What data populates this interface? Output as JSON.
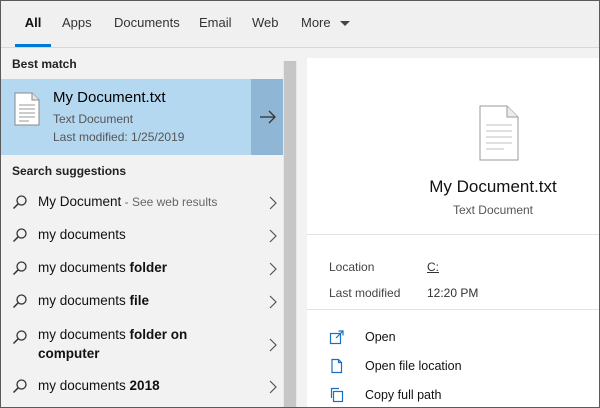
{
  "tabs": [
    {
      "label": "All",
      "active": true
    },
    {
      "label": "Apps"
    },
    {
      "label": "Documents"
    },
    {
      "label": "Email"
    },
    {
      "label": "Web"
    },
    {
      "label": "More"
    }
  ],
  "best_match": {
    "section_label": "Best match",
    "title": "My Document.txt",
    "type": "Text Document",
    "modified": "Last modified: 1/25/2019"
  },
  "suggestions": {
    "section_label": "Search suggestions",
    "items": [
      {
        "base": "My Document",
        "bold": "",
        "hint": " - See web results"
      },
      {
        "base": "my documents",
        "bold": "",
        "hint": ""
      },
      {
        "base": "my documents ",
        "bold": "folder",
        "hint": ""
      },
      {
        "base": "my documents ",
        "bold": "file",
        "hint": ""
      },
      {
        "base": "my documents ",
        "bold": "folder on computer",
        "hint": ""
      },
      {
        "base": "my documents ",
        "bold": "2018",
        "hint": ""
      }
    ]
  },
  "preview": {
    "title": "My Document.txt",
    "type": "Text Document",
    "location_label": "Location",
    "location_value": "C:",
    "modified_label": "Last modified",
    "modified_value": "12:20 PM",
    "actions": [
      {
        "label": "Open",
        "icon": "open-icon"
      },
      {
        "label": "Open file location",
        "icon": "file-location-icon"
      },
      {
        "label": "Copy full path",
        "icon": "copy-path-icon"
      }
    ]
  },
  "colors": {
    "accent": "#0078d7",
    "selected_bg": "#b4d8f0",
    "arrow_btn_bg": "#8fb6d4",
    "pane_bg": "#f2f2f2"
  }
}
